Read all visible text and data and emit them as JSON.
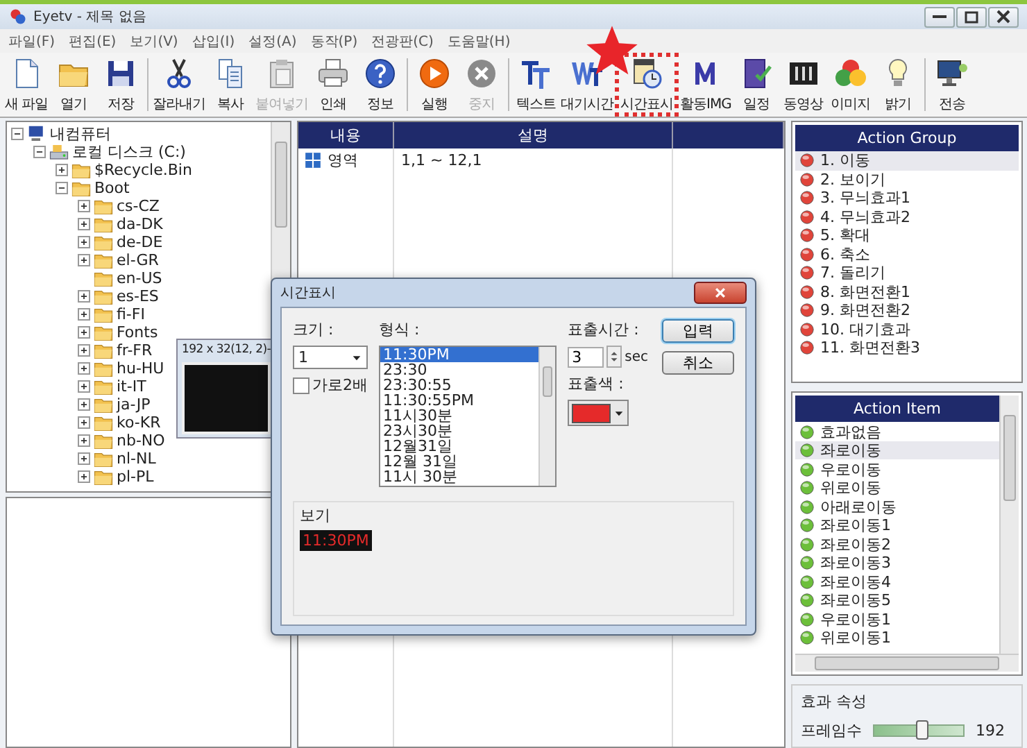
{
  "window": {
    "title": "Eyetv - 제목 없음"
  },
  "menu": [
    "파일(F)",
    "편집(E)",
    "보기(V)",
    "삽입(I)",
    "설정(A)",
    "동작(P)",
    "전광판(C)",
    "도움말(H)"
  ],
  "toolbar": [
    {
      "label": "새 파일",
      "kind": "document",
      "disabled": false,
      "highlighted": false
    },
    {
      "label": "열기",
      "kind": "folder",
      "disabled": false,
      "highlighted": false
    },
    {
      "label": "저장",
      "kind": "floppy",
      "disabled": false,
      "highlighted": false
    },
    {
      "label": "잘라내기",
      "kind": "scissors",
      "disabled": false,
      "highlighted": false,
      "group_start": true
    },
    {
      "label": "복사",
      "kind": "copy",
      "disabled": false,
      "highlighted": false
    },
    {
      "label": "붙여넣기",
      "kind": "clipboard",
      "disabled": true,
      "highlighted": false
    },
    {
      "label": "인쇄",
      "kind": "printer",
      "disabled": false,
      "highlighted": false
    },
    {
      "label": "정보",
      "kind": "help",
      "disabled": false,
      "highlighted": false
    },
    {
      "label": "실행",
      "kind": "play",
      "disabled": false,
      "highlighted": false,
      "group_start": true
    },
    {
      "label": "중지",
      "kind": "stop",
      "disabled": true,
      "highlighted": false
    },
    {
      "label": "텍스트",
      "kind": "text-tt",
      "disabled": false,
      "highlighted": false,
      "group_start": true
    },
    {
      "label": "대기시간",
      "kind": "text-wt",
      "disabled": false,
      "highlighted": false
    },
    {
      "label": "시간표시",
      "kind": "calendar-clock",
      "disabled": false,
      "highlighted": true
    },
    {
      "label": "활동IMG",
      "kind": "letter-m",
      "disabled": false,
      "highlighted": false
    },
    {
      "label": "일정",
      "kind": "book",
      "disabled": false,
      "highlighted": false
    },
    {
      "label": "동영상",
      "kind": "film",
      "disabled": false,
      "highlighted": false
    },
    {
      "label": "이미지",
      "kind": "colors",
      "disabled": false,
      "highlighted": false
    },
    {
      "label": "밝기",
      "kind": "bulb",
      "disabled": false,
      "highlighted": false
    },
    {
      "label": "전송",
      "kind": "monitor",
      "disabled": false,
      "highlighted": false,
      "group_start": true
    }
  ],
  "tree": [
    {
      "label": "내컴퓨터",
      "kind": "computer",
      "expanded": true,
      "children": [
        {
          "label": "로컬 디스크 (C:)",
          "kind": "drive",
          "expanded": true,
          "children": [
            {
              "label": "$Recycle.Bin",
              "kind": "folder",
              "expanded": false
            },
            {
              "label": "Boot",
              "kind": "folder",
              "expanded": true,
              "children": [
                {
                  "label": "cs-CZ",
                  "kind": "folder",
                  "expanded": false
                },
                {
                  "label": "da-DK",
                  "kind": "folder",
                  "expanded": false
                },
                {
                  "label": "de-DE",
                  "kind": "folder",
                  "expanded": false
                },
                {
                  "label": "el-GR",
                  "kind": "folder",
                  "expanded": false
                },
                {
                  "label": "en-US",
                  "kind": "leaf-folder"
                },
                {
                  "label": "es-ES",
                  "kind": "folder",
                  "expanded": false
                },
                {
                  "label": "fi-FI",
                  "kind": "folder",
                  "expanded": false
                },
                {
                  "label": "Fonts",
                  "kind": "folder",
                  "expanded": false
                },
                {
                  "label": "fr-FR",
                  "kind": "folder",
                  "expanded": false
                },
                {
                  "label": "hu-HU",
                  "kind": "folder",
                  "expanded": false
                },
                {
                  "label": "it-IT",
                  "kind": "folder",
                  "expanded": false
                },
                {
                  "label": "ja-JP",
                  "kind": "folder",
                  "expanded": false
                },
                {
                  "label": "ko-KR",
                  "kind": "folder",
                  "expanded": false
                },
                {
                  "label": "nb-NO",
                  "kind": "folder",
                  "expanded": false
                },
                {
                  "label": "nl-NL",
                  "kind": "folder",
                  "expanded": false
                },
                {
                  "label": "pl-PL",
                  "kind": "folder",
                  "expanded": false
                }
              ]
            }
          ]
        }
      ]
    }
  ],
  "table": {
    "columns": [
      "내용",
      "설명"
    ],
    "rows": [
      {
        "cells": [
          "영역",
          "1,1 ~ 12,1"
        ]
      }
    ]
  },
  "action_group": {
    "title": "Action Group",
    "items": [
      {
        "label": "1. 이동",
        "selected": true
      },
      {
        "label": "2. 보이기",
        "selected": false
      },
      {
        "label": "3. 무늬효과1",
        "selected": false
      },
      {
        "label": "4. 무늬효과2",
        "selected": false
      },
      {
        "label": "5. 확대",
        "selected": false
      },
      {
        "label": "6. 축소",
        "selected": false
      },
      {
        "label": "7. 돌리기",
        "selected": false
      },
      {
        "label": "8. 화면전환1",
        "selected": false
      },
      {
        "label": "9. 화면전환2",
        "selected": false
      },
      {
        "label": "10. 대기효과",
        "selected": false
      },
      {
        "label": "11. 화면전환3",
        "selected": false
      }
    ]
  },
  "action_item": {
    "title": "Action Item",
    "items": [
      {
        "label": "효과없음",
        "selected": false
      },
      {
        "label": "좌로이동",
        "selected": true
      },
      {
        "label": "우로이동",
        "selected": false
      },
      {
        "label": "위로이동",
        "selected": false
      },
      {
        "label": "아래로이동",
        "selected": false
      },
      {
        "label": "좌로이동1",
        "selected": false
      },
      {
        "label": "좌로이동2",
        "selected": false
      },
      {
        "label": "좌로이동3",
        "selected": false
      },
      {
        "label": "좌로이동4",
        "selected": false
      },
      {
        "label": "좌로이동5",
        "selected": false
      },
      {
        "label": "우로이동1",
        "selected": false
      },
      {
        "label": "위로이동1",
        "selected": false
      }
    ]
  },
  "effect_properties": {
    "title": "효과 속성",
    "frame_count": {
      "label": "프레임수",
      "level": 0.55,
      "value": "192"
    }
  },
  "preview_window": {
    "title": "192 x 32(12, 2)-"
  },
  "dialog": {
    "title": "시간표시",
    "size": {
      "label": "크기 :",
      "value": "1"
    },
    "double_width": {
      "label": "가로2배",
      "checked": false
    },
    "format": {
      "label": "형식 :",
      "options": [
        {
          "label": "11:30PM",
          "selected": true
        },
        {
          "label": "23:30",
          "selected": false
        },
        {
          "label": "23:30:55",
          "selected": false
        },
        {
          "label": "11:30:55PM",
          "selected": false
        },
        {
          "label": "11시30분",
          "selected": false
        },
        {
          "label": "23시30분",
          "selected": false
        },
        {
          "label": "12월31일",
          "selected": false
        },
        {
          "label": "12월 31일",
          "selected": false
        },
        {
          "label": "11시 30분",
          "selected": false
        }
      ]
    },
    "duration": {
      "label": "표출시간 :",
      "value": "3",
      "unit": "sec"
    },
    "color": {
      "label": "표출색 :",
      "color": "#e52a2a"
    },
    "buttons": [
      {
        "label": "입력",
        "default": true
      },
      {
        "label": "취소",
        "default": false
      }
    ],
    "preview": {
      "label": "보기",
      "text": "11:30PM"
    }
  }
}
